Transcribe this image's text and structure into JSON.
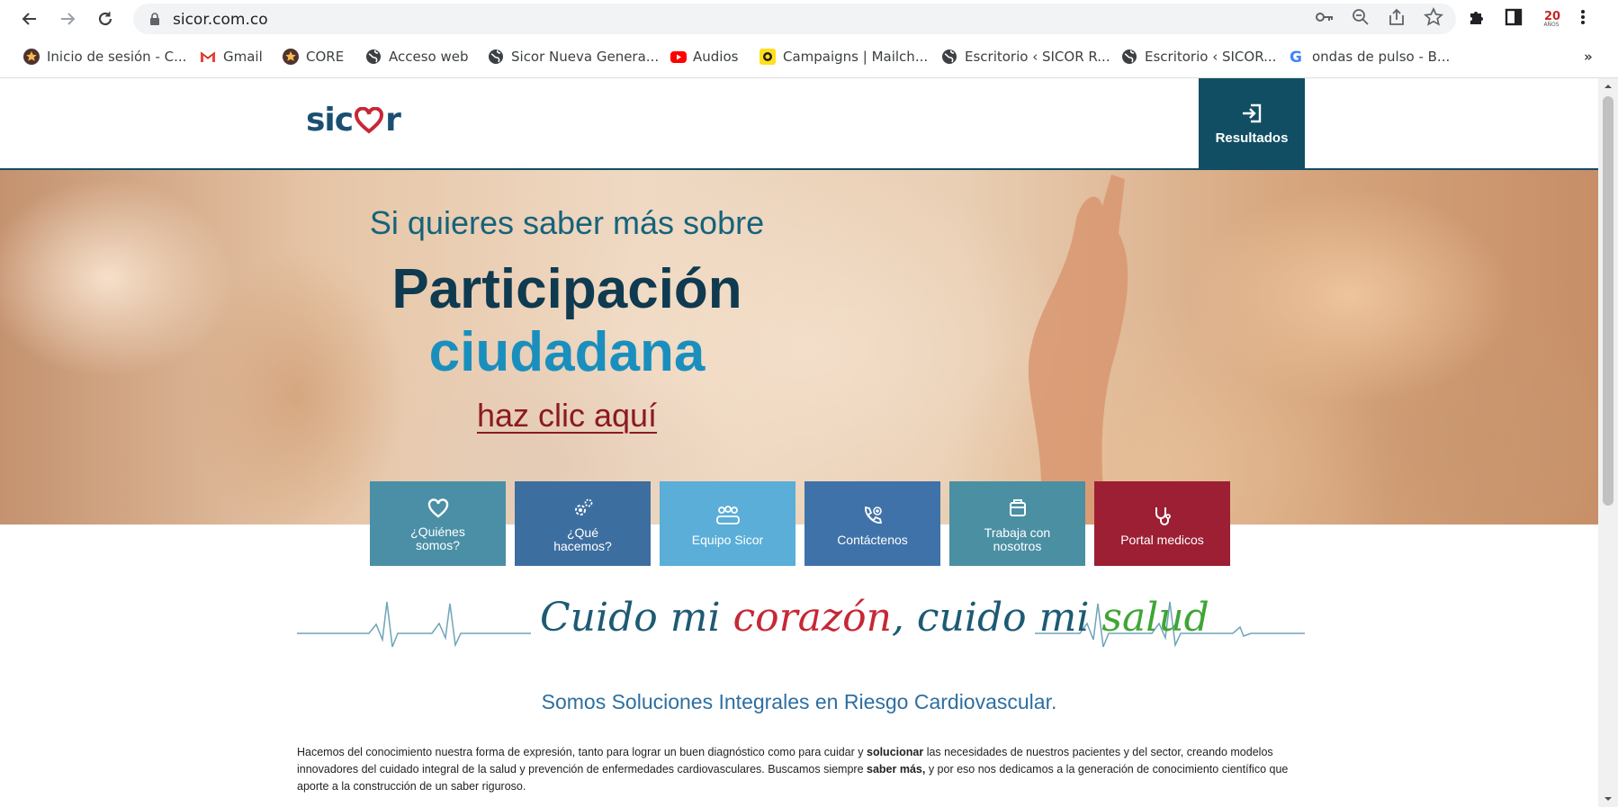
{
  "browser": {
    "url": "sicor.com.co",
    "bookmarks": [
      {
        "label": "Inicio de sesión - C...",
        "icon": "star-coin-icon"
      },
      {
        "label": "Gmail",
        "icon": "gmail-icon"
      },
      {
        "label": "CORE",
        "icon": "star-coin-icon"
      },
      {
        "label": "Acceso web",
        "icon": "globe-icon"
      },
      {
        "label": "Sicor Nueva Genera...",
        "icon": "globe-icon"
      },
      {
        "label": "Audios",
        "icon": "youtube-icon"
      },
      {
        "label": "Campaigns | Mailch...",
        "icon": "mailchimp-icon"
      },
      {
        "label": "Escritorio ‹ SICOR R...",
        "icon": "globe-icon"
      },
      {
        "label": "Escritorio ‹ SICOR...",
        "icon": "globe-icon"
      },
      {
        "label": "ondas de pulso - B...",
        "icon": "google-icon"
      }
    ],
    "overflow": "»",
    "badge_text": "AÑOS"
  },
  "site": {
    "logo": {
      "prefix": "sic",
      "suffix": "r"
    },
    "resultados": "Resultados",
    "hero": {
      "subtitle": "Si quieres saber más sobre",
      "title_line1": "Participación",
      "title_line2": "ciudadana",
      "link": "haz clic aquí"
    },
    "tiles": [
      {
        "label": "¿Quiénes somos?",
        "color": "#4a8fa6",
        "icon": "heart-icon"
      },
      {
        "label": "¿Qué hacemos?",
        "color": "#3d6ea0",
        "icon": "gears-icon"
      },
      {
        "label": "Equipo Sicor",
        "color": "#5aaed8",
        "icon": "team-icon"
      },
      {
        "label": "Contáctenos",
        "color": "#3f72a8",
        "icon": "phone-icon"
      },
      {
        "label": "Trabaja con nosotros",
        "color": "#4b8fa3",
        "icon": "job-icon"
      },
      {
        "label": "Portal medicos",
        "color": "#9c1f34",
        "icon": "stethoscope-icon"
      }
    ],
    "slogan": {
      "part1": "Cuido mi ",
      "part2": "corazón",
      "part3": ", cuido mi ",
      "part4": "salud"
    },
    "tagline": "Somos Soluciones Integrales en Riesgo Cardiovascular.",
    "paragraph": {
      "s1": "Hacemos del conocimiento nuestra forma de expresión, tanto para lograr un buen diagnóstico como para cuidar y ",
      "b1": "solucionar",
      "s2": " las necesidades de nuestros pacientes y del sector, creando modelos innovadores del cuidado integral de la salud y prevención de enfermedades cardiovasculares. Buscamos siempre ",
      "b2": "saber más,",
      "s3": " y por eso nos dedicamos a la generación de conocimiento científico que aporte a la construcción de un saber riguroso."
    }
  }
}
